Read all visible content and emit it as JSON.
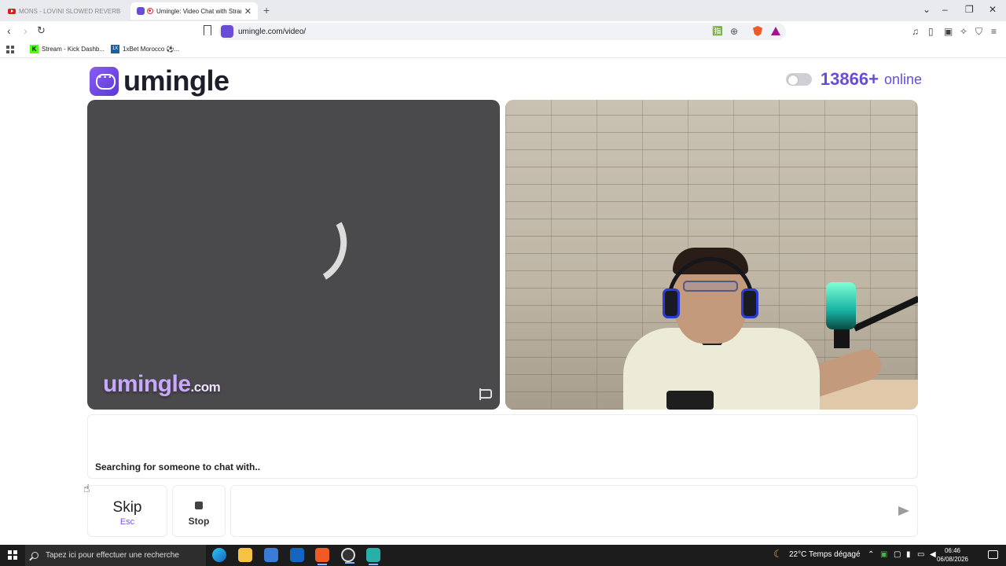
{
  "browser": {
    "tabs": [
      {
        "title": "MONS - LOVINI SLOWED REVERB",
        "active": false
      },
      {
        "title": "Umingle: Video Chat with Strangers",
        "active": true
      }
    ],
    "new_tab_icon": "+",
    "url": "umingle.com/video/",
    "bookmarks": [
      {
        "label": "Stream - Kick Dashb..."
      },
      {
        "label": "1xBet Morocco ⚽..."
      }
    ],
    "window_controls": {
      "minimize": "–",
      "restore": "❐",
      "close": "✕",
      "dropdown": "⌄"
    },
    "nav": {
      "back": "‹",
      "forward": "›",
      "reload": "↻"
    },
    "right_tools": [
      "♫",
      "▯",
      "▣",
      "✧",
      "⛉",
      "≡"
    ],
    "url_tools": [
      "🈯",
      "⊕"
    ]
  },
  "page": {
    "logo_text": "umingle",
    "online_count": "13866+",
    "online_label": "online",
    "watermark_main": "umingle",
    "watermark_suffix": ".com",
    "chat_status": "Searching for someone to chat with..",
    "skip": {
      "label": "Skip",
      "shortcut": "Esc"
    },
    "stop": {
      "label": "Stop"
    },
    "message_placeholder": ""
  },
  "taskbar": {
    "search_placeholder": "Tapez ici pour effectuer une recherche",
    "weather": "22°C  Temps dégagé",
    "time": "06:46",
    "date": "06/08/2026"
  },
  "colors": {
    "accent": "#6a4bd6",
    "watermark": "#c9a8ff",
    "video_bg": "#4a4a4c",
    "taskbar": "#1c1c1c"
  }
}
